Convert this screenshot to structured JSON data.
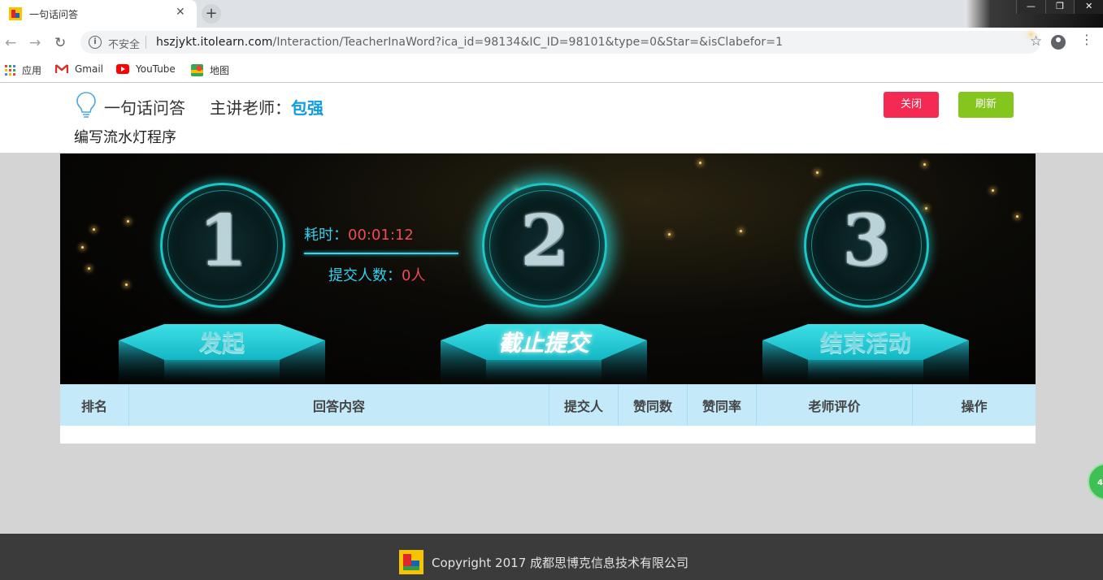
{
  "browser": {
    "tab_title": "一句话问答",
    "tab_close": "✕",
    "new_tab": "+",
    "insecure_label": "不安全",
    "url_host": "hszjykt.itolearn.com",
    "url_path": "/Interaction/TeacherInaWord?ica_id=98134&IC_ID=98101&type=0&Star=&isClabefor=1",
    "window_controls": [
      "—",
      "❐",
      "✕"
    ],
    "bookmarks": [
      {
        "label": "应用",
        "icon": "apps-grid-icon"
      },
      {
        "label": "Gmail",
        "icon": "gmail-icon"
      },
      {
        "label": "YouTube",
        "icon": "youtube-icon"
      },
      {
        "label": "地图",
        "icon": "maps-icon"
      }
    ]
  },
  "header": {
    "app_title": "一句话问答",
    "teacher_label": "主讲老师：",
    "teacher_name": "包强",
    "question": "编写流水灯程序",
    "close_label": "关闭",
    "refresh_label": "刷新"
  },
  "stage": {
    "steps": [
      {
        "number": "1",
        "label": "发起"
      },
      {
        "number": "2",
        "label": "截止提交"
      },
      {
        "number": "3",
        "label": "结束活动"
      }
    ],
    "active_step": "2",
    "timer_label": "耗时：",
    "timer_value": "00:01:12",
    "submit_label": "提交人数：",
    "submit_value": "0人"
  },
  "table": {
    "columns": [
      "排名",
      "回答内容",
      "提交人",
      "赞同数",
      "赞同率",
      "老师评价",
      "操作"
    ]
  },
  "float_badge": "46",
  "footer": {
    "copyright": "Copyright 2017 成都思博克信息技术有限公司"
  },
  "colors": {
    "close_btn": "#f52a52",
    "refresh_btn": "#84c51e",
    "teacher_name": "#0e9be0",
    "table_header": "#c4eaf9",
    "accent_cyan": "#2fd1ee",
    "value_red": "#f04a5a"
  }
}
